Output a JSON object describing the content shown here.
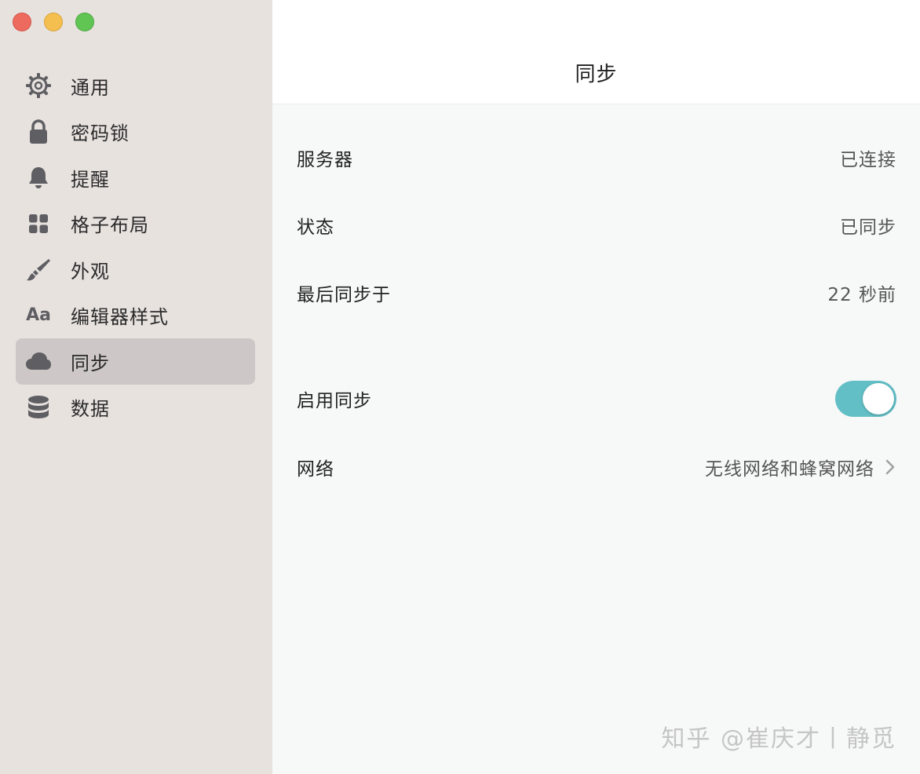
{
  "window": {
    "traffic_lights": [
      "close",
      "minimize",
      "maximize"
    ]
  },
  "sidebar": {
    "items": [
      {
        "label": "通用",
        "icon": "gear-icon",
        "active": false
      },
      {
        "label": "密码锁",
        "icon": "lock-icon",
        "active": false
      },
      {
        "label": "提醒",
        "icon": "bell-icon",
        "active": false
      },
      {
        "label": "格子布局",
        "icon": "grid-icon",
        "active": false
      },
      {
        "label": "外观",
        "icon": "paintbrush-icon",
        "active": false
      },
      {
        "label": "编辑器样式",
        "icon": "text-style-icon",
        "icon_text": "Aa",
        "active": false
      },
      {
        "label": "同步",
        "icon": "cloud-icon",
        "active": true
      },
      {
        "label": "数据",
        "icon": "database-icon",
        "active": false
      }
    ]
  },
  "main": {
    "title": "同步",
    "rows": {
      "server": {
        "label": "服务器",
        "value": "已连接"
      },
      "status": {
        "label": "状态",
        "value": "已同步"
      },
      "last_sync": {
        "label": "最后同步于",
        "value": "22 秒前"
      },
      "enable_sync": {
        "label": "启用同步",
        "enabled": true
      },
      "network": {
        "label": "网络",
        "value": "无线网络和蜂窝网络"
      }
    }
  },
  "watermark": "知乎 @崔庆才丨静觅",
  "colors": {
    "sidebar_bg": "#e8e2df",
    "active_item_bg": "#cdc8c7",
    "toggle_on": "#62bfc6",
    "main_bg": "#f7f8f8"
  }
}
